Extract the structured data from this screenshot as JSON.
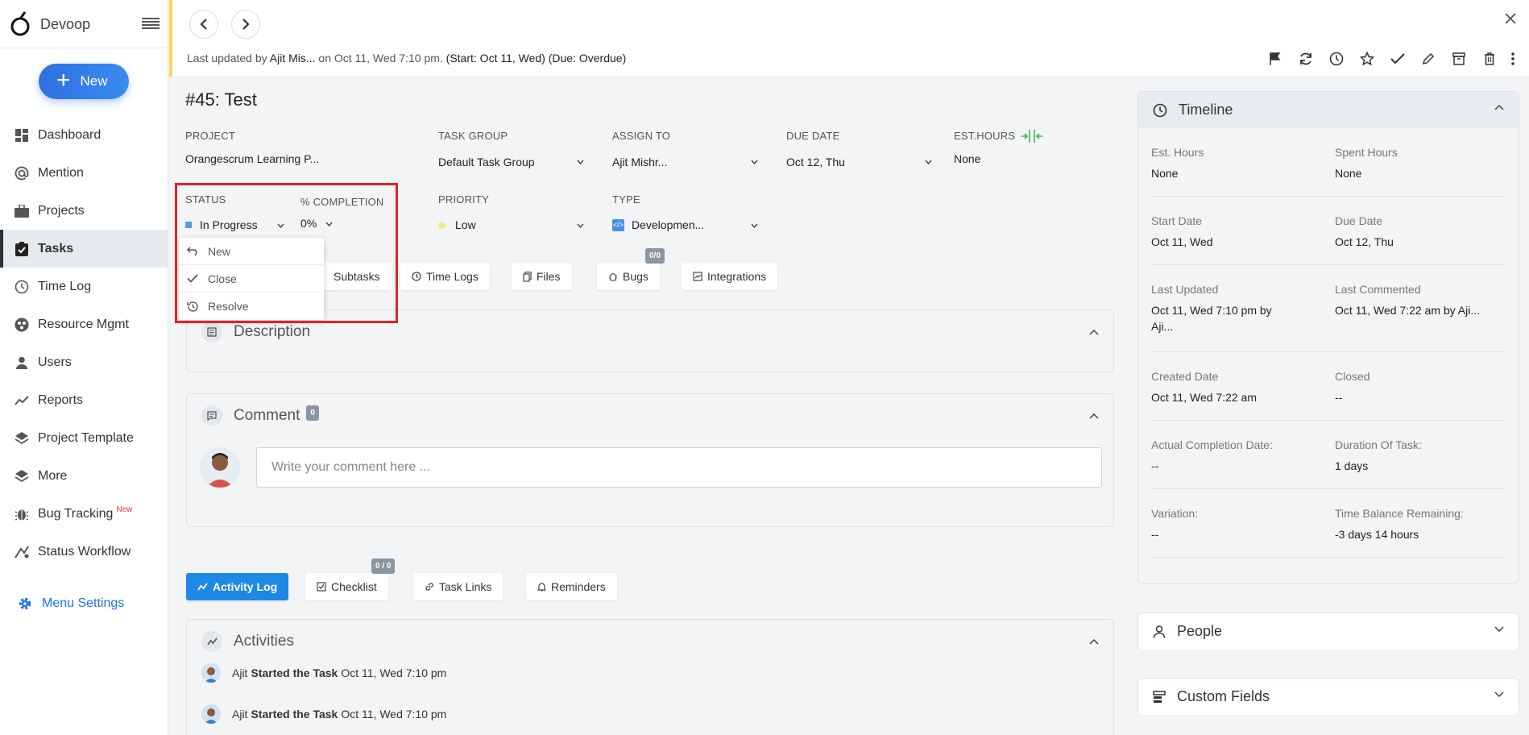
{
  "brand": {
    "name": "Devoop"
  },
  "sidebar": {
    "new_label": "New",
    "items": [
      {
        "label": "Dashboard",
        "icon": "dashboard-icon"
      },
      {
        "label": "Mention",
        "icon": "at-icon"
      },
      {
        "label": "Projects",
        "icon": "briefcase-icon"
      },
      {
        "label": "Tasks",
        "icon": "clipboard-check-icon",
        "active": true
      },
      {
        "label": "Time Log",
        "icon": "clock-icon"
      },
      {
        "label": "Resource Mgmt",
        "icon": "resource-icon"
      },
      {
        "label": "Users",
        "icon": "user-icon"
      },
      {
        "label": "Reports",
        "icon": "trend-icon"
      },
      {
        "label": "Project Template",
        "icon": "layers-icon"
      },
      {
        "label": "More",
        "icon": "layers-icon"
      },
      {
        "label": "Bug Tracking",
        "icon": "bug-icon",
        "badge": "New"
      },
      {
        "label": "Status Workflow",
        "icon": "workflow-icon"
      }
    ],
    "menu_settings": "Menu Settings"
  },
  "header": {
    "updated_prefix": "Last updated by ",
    "updated_user": "Ajit Mis...",
    "updated_mid": " on Oct 11, Wed 7:10 pm. ",
    "updated_suffix": "(Start: Oct 11, Wed) (Due: Overdue)"
  },
  "task": {
    "title": "#45: Test",
    "project_label": "PROJECT",
    "project": "Orangescrum Learning P...",
    "group_label": "TASK GROUP",
    "group": "Default Task Group",
    "assign_label": "ASSIGN TO",
    "assign": "Ajit Mishr...",
    "due_label": "DUE DATE",
    "due": "Oct 12, Thu",
    "est_label": "EST.HOURS",
    "est": "None",
    "status_label": "STATUS",
    "status": "In Progress",
    "completion_label": "% COMPLETION",
    "completion": "0%",
    "priority_label": "PRIORITY",
    "priority": "Low",
    "type_label": "TYPE",
    "type": "Developmen..."
  },
  "status_dropdown": [
    "New",
    "Close",
    "Resolve"
  ],
  "tabs": [
    {
      "label": "Subtasks"
    },
    {
      "label": "Time Logs"
    },
    {
      "label": "Files"
    },
    {
      "label": "Bugs",
      "badge": "0/0"
    },
    {
      "label": "Integrations"
    }
  ],
  "description": {
    "title": "Description"
  },
  "comment": {
    "title": "Comment",
    "count": "0",
    "placeholder": "Write your comment here ..."
  },
  "bottom_tabs": [
    {
      "label": "Activity Log"
    },
    {
      "label": "Checklist",
      "badge": "0 / 0"
    },
    {
      "label": "Task Links"
    },
    {
      "label": "Reminders"
    }
  ],
  "activities": {
    "title": "Activities",
    "rows": [
      {
        "user": "Ajit",
        "action": "Started the Task",
        "time": "Oct 11, Wed 7:10 pm"
      },
      {
        "user": "Ajit",
        "action": "Started the Task",
        "time": "Oct 11, Wed 7:10 pm"
      }
    ]
  },
  "timeline": {
    "title": "Timeline",
    "rows": [
      [
        {
          "label": "Est. Hours",
          "value": "None"
        },
        {
          "label": "Spent Hours",
          "value": "None"
        }
      ],
      [
        {
          "label": "Start Date",
          "value": "Oct 11, Wed"
        },
        {
          "label": "Due Date",
          "value": "Oct 12, Thu"
        }
      ],
      [
        {
          "label": "Last Updated",
          "value": "Oct 11, Wed 7:10 pm by Aji..."
        },
        {
          "label": "Last Commented",
          "value": "Oct 11, Wed 7:22 am by Aji..."
        }
      ],
      [
        {
          "label": "Created Date",
          "value": "Oct 11, Wed 7:22 am"
        },
        {
          "label": "Closed",
          "value": "--"
        }
      ],
      [
        {
          "label": "Actual Completion Date:",
          "value": "--"
        },
        {
          "label": "Duration Of Task:",
          "value": "1 days"
        }
      ],
      [
        {
          "label": "Variation:",
          "value": "--"
        },
        {
          "label": "Time Balance Remaining:",
          "value": "-3 days 14 hours"
        }
      ]
    ]
  },
  "people": {
    "title": "People"
  },
  "custom_fields": {
    "title": "Custom Fields"
  },
  "colors": {
    "accent": "#1e88e5",
    "highlight": "#e02424",
    "overdue_bar": "#f4d85a"
  }
}
